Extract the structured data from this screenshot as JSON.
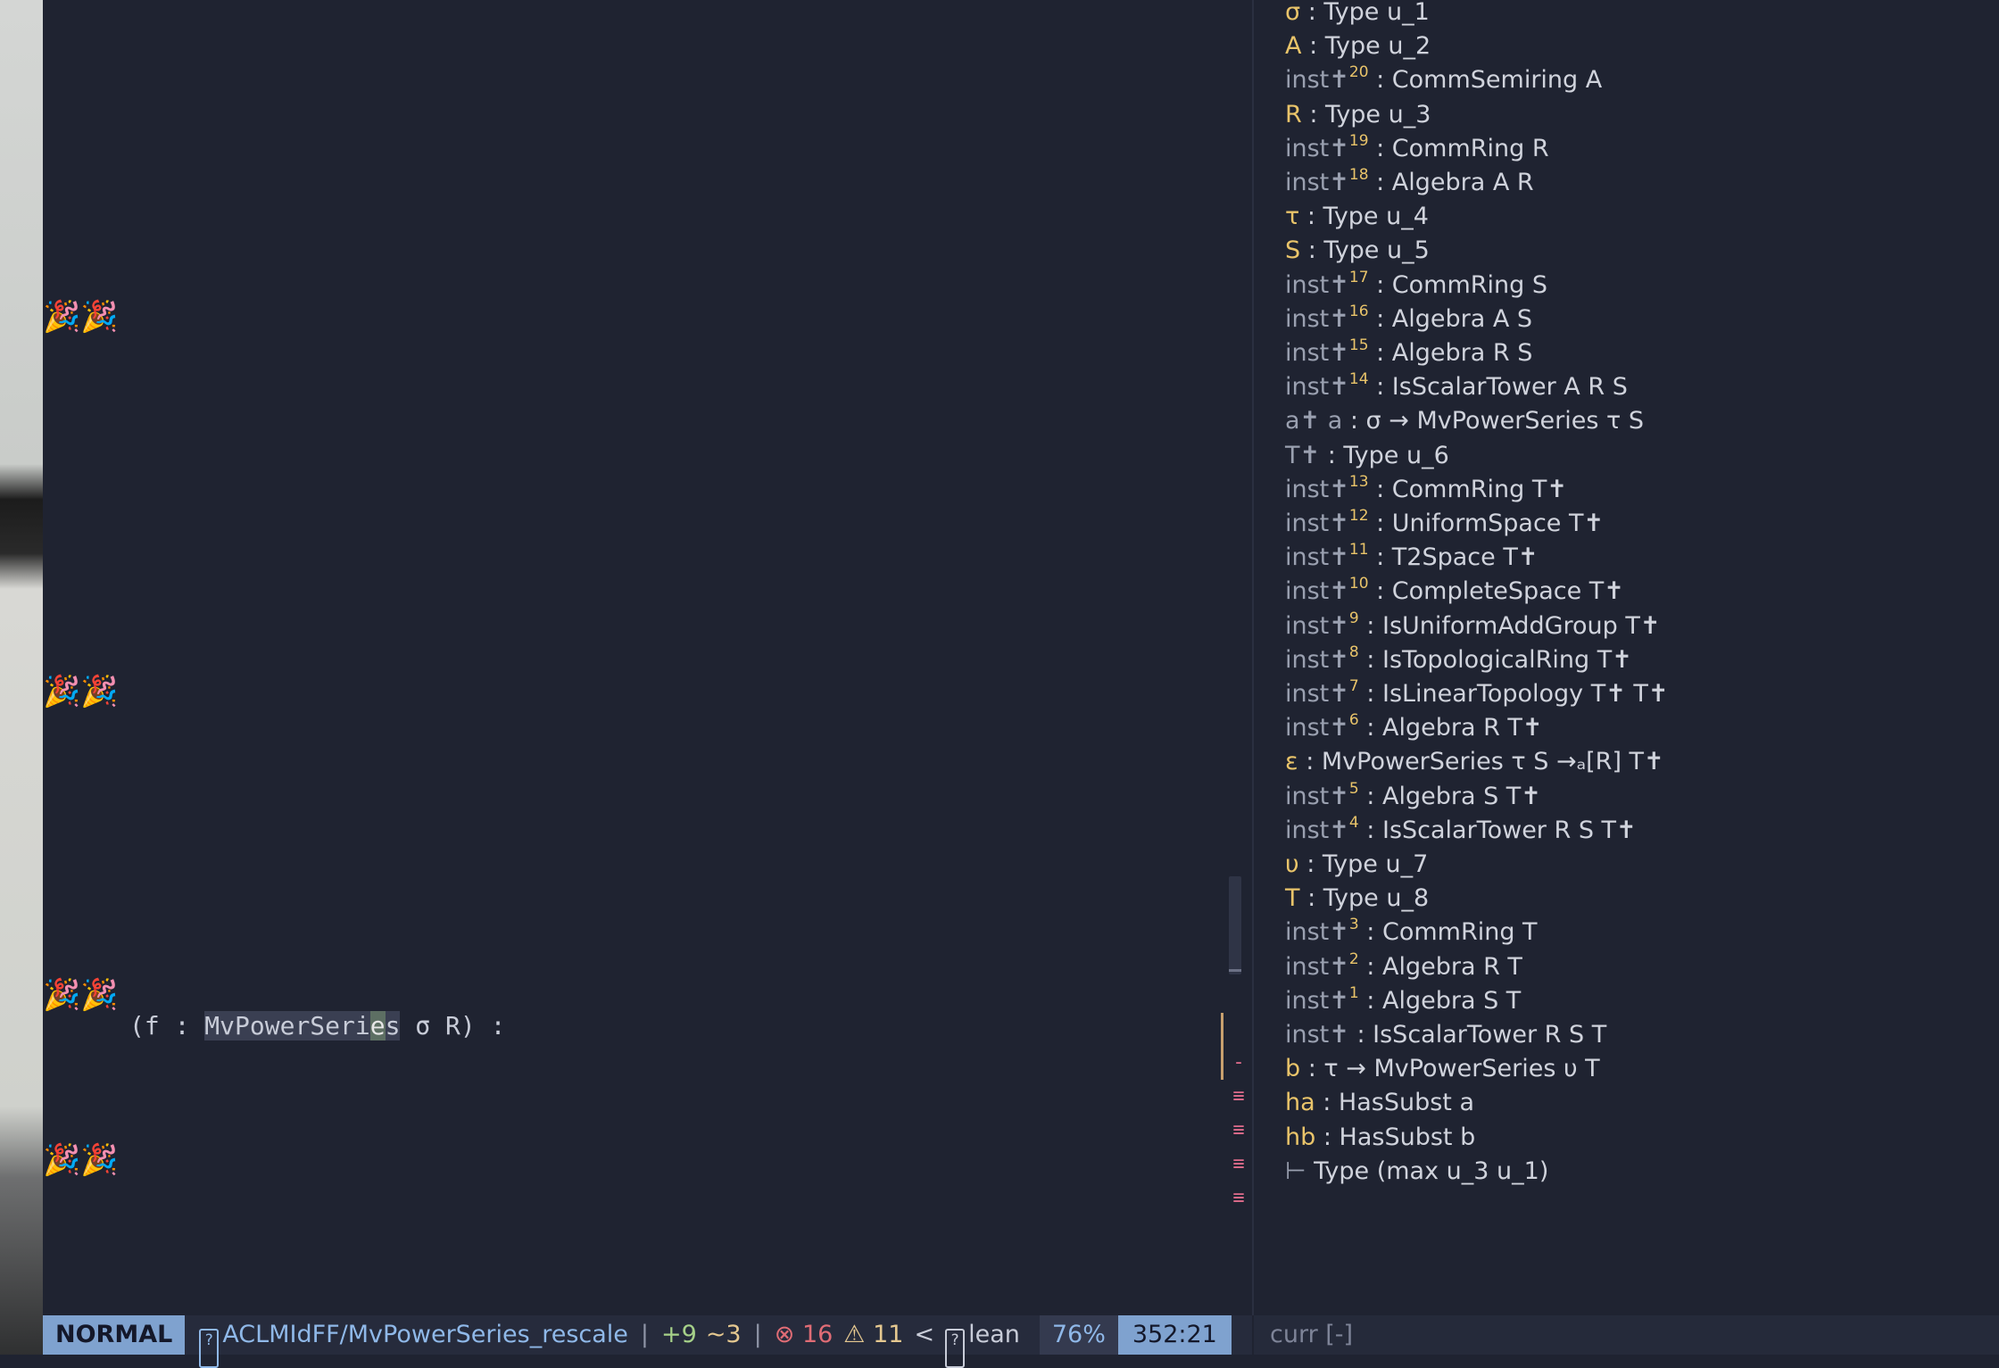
{
  "editor": {
    "decorations": [
      "🎉🎉",
      "🎉🎉",
      "🎉🎉",
      "🎉🎉"
    ],
    "code_line": {
      "prefix": "(f : ",
      "type_name_a": "MvPowerSeri",
      "cursor_char": "e",
      "type_name_b": "s",
      "suffix": " σ R) :"
    },
    "diagnostic_signs": [
      "-",
      "≡",
      "≡",
      "≡",
      "≡"
    ]
  },
  "infoview": {
    "hypotheses": [
      {
        "name": "σ",
        "kind": "name",
        "sup": "",
        "type": " : Type u_1"
      },
      {
        "name": "A",
        "kind": "name",
        "sup": "",
        "type": " : Type u_2"
      },
      {
        "name": "inst✝",
        "kind": "inst",
        "sup": "20",
        "type": " : CommSemiring A"
      },
      {
        "name": "R",
        "kind": "name",
        "sup": "",
        "type": " : Type u_3"
      },
      {
        "name": "inst✝",
        "kind": "inst",
        "sup": "19",
        "type": " : CommRing R"
      },
      {
        "name": "inst✝",
        "kind": "inst",
        "sup": "18",
        "type": " : Algebra A R"
      },
      {
        "name": "τ",
        "kind": "name",
        "sup": "",
        "type": " : Type u_4"
      },
      {
        "name": "S",
        "kind": "name",
        "sup": "",
        "type": " : Type u_5"
      },
      {
        "name": "inst✝",
        "kind": "inst",
        "sup": "17",
        "type": " : CommRing S"
      },
      {
        "name": "inst✝",
        "kind": "inst",
        "sup": "16",
        "type": " : Algebra A S"
      },
      {
        "name": "inst✝",
        "kind": "inst",
        "sup": "15",
        "type": " : Algebra R S"
      },
      {
        "name": "inst✝",
        "kind": "inst",
        "sup": "14",
        "type": " : IsScalarTower A R S"
      },
      {
        "name": "a✝ a",
        "kind": "inst",
        "sup": "",
        "type": " : σ → MvPowerSeries τ S"
      },
      {
        "name": "T✝",
        "kind": "inst",
        "sup": "",
        "type": " : Type u_6"
      },
      {
        "name": "inst✝",
        "kind": "inst",
        "sup": "13",
        "type": " : CommRing T✝"
      },
      {
        "name": "inst✝",
        "kind": "inst",
        "sup": "12",
        "type": " : UniformSpace T✝"
      },
      {
        "name": "inst✝",
        "kind": "inst",
        "sup": "11",
        "type": " : T2Space T✝"
      },
      {
        "name": "inst✝",
        "kind": "inst",
        "sup": "10",
        "type": " : CompleteSpace T✝"
      },
      {
        "name": "inst✝",
        "kind": "inst",
        "sup": "9",
        "type": " : IsUniformAddGroup T✝"
      },
      {
        "name": "inst✝",
        "kind": "inst",
        "sup": "8",
        "type": " : IsTopologicalRing T✝"
      },
      {
        "name": "inst✝",
        "kind": "inst",
        "sup": "7",
        "type": " : IsLinearTopology T✝ T✝"
      },
      {
        "name": "inst✝",
        "kind": "inst",
        "sup": "6",
        "type": " : Algebra R T✝"
      },
      {
        "name": "ε",
        "kind": "name",
        "sup": "",
        "type": " : MvPowerSeries τ S →ₐ[R] T✝"
      },
      {
        "name": "inst✝",
        "kind": "inst",
        "sup": "5",
        "type": " : Algebra S T✝"
      },
      {
        "name": "inst✝",
        "kind": "inst",
        "sup": "4",
        "type": " : IsScalarTower R S T✝"
      },
      {
        "name": "υ",
        "kind": "name",
        "sup": "",
        "type": " : Type u_7"
      },
      {
        "name": "T",
        "kind": "name",
        "sup": "",
        "type": " : Type u_8"
      },
      {
        "name": "inst✝",
        "kind": "inst",
        "sup": "3",
        "type": " : CommRing T"
      },
      {
        "name": "inst✝",
        "kind": "inst",
        "sup": "2",
        "type": " : Algebra R T"
      },
      {
        "name": "inst✝",
        "kind": "inst",
        "sup": "1",
        "type": " : Algebra S T"
      },
      {
        "name": "inst✝",
        "kind": "inst",
        "sup": "",
        "type": " : IsScalarTower R S T"
      },
      {
        "name": "b",
        "kind": "name",
        "sup": "",
        "type": " : τ → MvPowerSeries υ T"
      },
      {
        "name": "ha",
        "kind": "name",
        "sup": "",
        "type": " : HasSubst a"
      },
      {
        "name": "hb",
        "kind": "name",
        "sup": "",
        "type": " : HasSubst b"
      }
    ],
    "goal_turnstile": "⊢",
    "goal": " Type (max u_3 u_1)",
    "status": "curr [-]"
  },
  "statusbar": {
    "mode": "NORMAL",
    "path_icon": "?",
    "path": "ACLMIdFF/MvPowerSeries_rescale",
    "sep1": "|",
    "added": "+9",
    "changed": "~3",
    "sep2": "|",
    "errors": "⊗ 16",
    "warnings": "⚠ 11",
    "lt": "<",
    "filetype_icon": "?",
    "filetype": "lean",
    "percent": "76%",
    "position": "352:21"
  },
  "colors": {
    "background": "#1f2331",
    "hypothesis_name": "#e9c46a",
    "mode_bg": "#7fa2cf",
    "error": "#e06c75",
    "warning": "#e5c890",
    "added": "#a6d189"
  }
}
